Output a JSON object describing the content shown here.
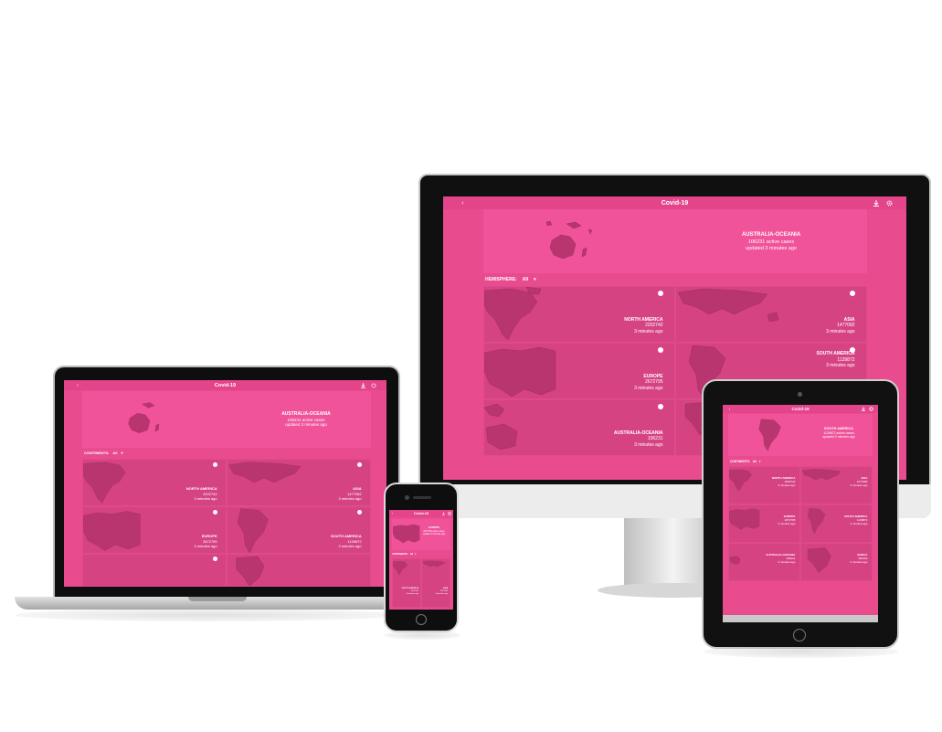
{
  "app": {
    "title": "Covid-19",
    "back_glyph": "‹",
    "icons": [
      "download-icon",
      "settings-icon"
    ],
    "hero": {
      "continent": "AUSTRALIA-OCEANIA",
      "cases": "106231 active cases",
      "updated": "updated 3 minutes ago"
    },
    "filter_label": "HEMISPHERE:",
    "filter_value": "All",
    "tiles": [
      {
        "name": "NORTH AMERICA",
        "value": "2202742",
        "updated": "3 minutes ago"
      },
      {
        "name": "ASIA",
        "value": "1477082",
        "updated": "3 minutes ago"
      },
      {
        "name": "EUROPE",
        "value": "2672795",
        "updated": "3 minutes ago"
      },
      {
        "name": "SOUTH AMERICA",
        "value": "1139872",
        "updated": "3 minutes ago"
      },
      {
        "name": "AUSTRALIA-OCEANIA",
        "value": "106231",
        "updated": "3 minutes ago"
      },
      {
        "name": "AFRICA",
        "value": "386160",
        "updated": "3 minutes ago"
      }
    ]
  },
  "laptop": {
    "filter_label": "CONTINENTS:",
    "filter_value": "All"
  },
  "phone": {
    "hero": {
      "continent": "EUROPE",
      "cases": "2672795 active cases",
      "updated": "updated 3 minutes ago"
    },
    "filter_label": "CONTINENTS:",
    "filter_value": "All"
  },
  "tablet": {
    "hero": {
      "continent": "SOUTH AMERICA",
      "cases": "1139872 active cases",
      "updated": "updated 3 minutes ago"
    },
    "filter_label": "CONTINENTS:",
    "filter_value": "All"
  },
  "colors": {
    "background": "#e94b8f",
    "hero": "#f0539a",
    "tile": "#d64383",
    "land": "#b8356f"
  }
}
